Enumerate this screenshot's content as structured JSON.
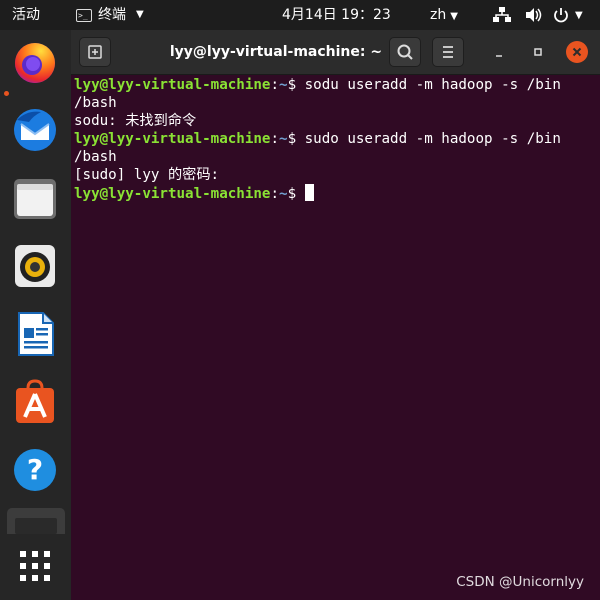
{
  "topbar": {
    "activities": "活动",
    "app_menu_label": "终端",
    "clock": "4月14日  19：23",
    "input_method": "zh",
    "tray_icons": [
      "network-icon",
      "volume-icon",
      "power-icon"
    ]
  },
  "dock": {
    "items": [
      "firefox-icon",
      "thunderbird-icon",
      "files-icon",
      "rhythmbox-icon",
      "libreoffice-writer-icon",
      "software-center-icon",
      "help-icon",
      "terminal-icon"
    ],
    "show_apps": "show-applications-icon"
  },
  "window": {
    "title": "lyy@lyy-virtual-machine: ~"
  },
  "terminal": {
    "line1": {
      "user": "lyy@lyy-virtual-machine",
      "path": "~",
      "cmd": "$ sodu useradd -m hadoop -s /bin"
    },
    "line2": "/bash",
    "line3": "sodu: 未找到命令",
    "line4": {
      "user": "lyy@lyy-virtual-machine",
      "path": "~",
      "cmd": "$ sudo useradd -m hadoop -s /bin"
    },
    "line5": "/bash",
    "line6": "[sudo] lyy 的密码:",
    "line7": {
      "user": "lyy@lyy-virtual-machine",
      "path": "~",
      "cmd": "$ "
    }
  },
  "colors": {
    "terminal_bg": "#300a24",
    "prompt_user": "#8ae234",
    "prompt_path": "#729fcf",
    "accent": "#e95420"
  },
  "watermark": "CSDN @Unicornlyy"
}
